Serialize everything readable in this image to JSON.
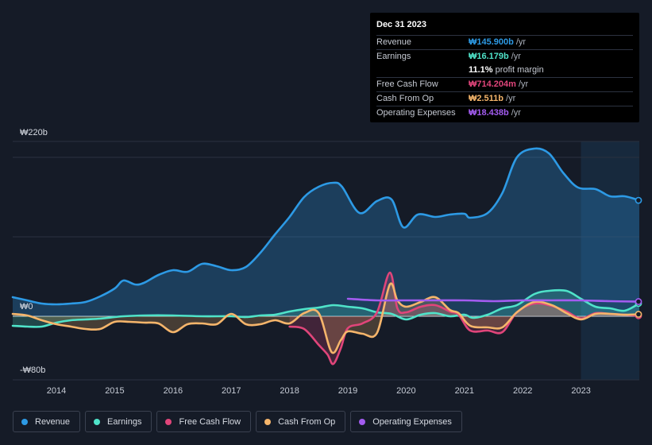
{
  "tooltip": {
    "date": "Dec 31 2023",
    "rows": [
      {
        "label": "Revenue",
        "value": "₩145.900b",
        "unit": "/yr",
        "color": "#2d9ae5"
      },
      {
        "label": "Earnings",
        "value": "₩16.179b",
        "unit": "/yr",
        "color": "#4fe3c9"
      },
      {
        "label": "",
        "value": "11.1%",
        "unit": "profit margin",
        "color": "#ffffff"
      },
      {
        "label": "Free Cash Flow",
        "value": "₩714.204m",
        "unit": "/yr",
        "color": "#e0457a"
      },
      {
        "label": "Cash From Op",
        "value": "₩2.511b",
        "unit": "/yr",
        "color": "#f5b56b"
      },
      {
        "label": "Operating Expenses",
        "value": "₩18.438b",
        "unit": "/yr",
        "color": "#a35cf0"
      }
    ]
  },
  "chart_data": {
    "type": "area",
    "yaxis_labels": {
      "top": "₩220b",
      "zero": "₩0",
      "bottom": "-₩80b"
    },
    "ylim": [
      -80,
      220
    ],
    "x_ticks": [
      "2014",
      "2015",
      "2016",
      "2017",
      "2018",
      "2019",
      "2020",
      "2021",
      "2022",
      "2023"
    ],
    "xlim": [
      2013.25,
      2024.0
    ],
    "highlight_start": 2023.0,
    "grid": true,
    "series": [
      {
        "name": "Revenue",
        "color": "#2d9ae5",
        "fill": true,
        "points": [
          [
            2013.25,
            24
          ],
          [
            2013.5,
            20
          ],
          [
            2013.75,
            16
          ],
          [
            2014.0,
            15
          ],
          [
            2014.25,
            16
          ],
          [
            2014.5,
            18
          ],
          [
            2014.75,
            25
          ],
          [
            2015.0,
            35
          ],
          [
            2015.15,
            45
          ],
          [
            2015.35,
            40
          ],
          [
            2015.5,
            42
          ],
          [
            2015.75,
            52
          ],
          [
            2016.0,
            58
          ],
          [
            2016.25,
            56
          ],
          [
            2016.5,
            66
          ],
          [
            2016.75,
            63
          ],
          [
            2017.0,
            58
          ],
          [
            2017.25,
            62
          ],
          [
            2017.5,
            80
          ],
          [
            2017.75,
            103
          ],
          [
            2018.0,
            125
          ],
          [
            2018.25,
            150
          ],
          [
            2018.5,
            163
          ],
          [
            2018.75,
            168
          ],
          [
            2018.9,
            163
          ],
          [
            2019.2,
            130
          ],
          [
            2019.5,
            145
          ],
          [
            2019.75,
            147
          ],
          [
            2019.95,
            112
          ],
          [
            2020.2,
            128
          ],
          [
            2020.5,
            125
          ],
          [
            2020.75,
            128
          ],
          [
            2021.0,
            129
          ],
          [
            2021.1,
            124
          ],
          [
            2021.4,
            130
          ],
          [
            2021.65,
            155
          ],
          [
            2021.9,
            200
          ],
          [
            2022.2,
            211
          ],
          [
            2022.45,
            205
          ],
          [
            2022.7,
            180
          ],
          [
            2022.95,
            162
          ],
          [
            2023.25,
            160
          ],
          [
            2023.5,
            151
          ],
          [
            2023.75,
            151
          ],
          [
            2024.0,
            145.9
          ]
        ]
      },
      {
        "name": "Earnings",
        "color": "#4fe3c9",
        "fill": true,
        "points": [
          [
            2013.25,
            -12
          ],
          [
            2013.5,
            -13
          ],
          [
            2013.75,
            -13
          ],
          [
            2014.0,
            -8
          ],
          [
            2014.25,
            -5
          ],
          [
            2014.5,
            -4
          ],
          [
            2014.75,
            -3
          ],
          [
            2015.0,
            -1
          ],
          [
            2015.15,
            0
          ],
          [
            2015.5,
            1
          ],
          [
            2016.0,
            1
          ],
          [
            2016.5,
            0
          ],
          [
            2017.0,
            0
          ],
          [
            2017.25,
            -1
          ],
          [
            2017.5,
            1
          ],
          [
            2017.75,
            2
          ],
          [
            2018.0,
            6
          ],
          [
            2018.25,
            9
          ],
          [
            2018.5,
            11
          ],
          [
            2018.75,
            14
          ],
          [
            2019.0,
            12
          ],
          [
            2019.25,
            10
          ],
          [
            2019.5,
            5
          ],
          [
            2019.75,
            3
          ],
          [
            2020.0,
            -4
          ],
          [
            2020.25,
            2
          ],
          [
            2020.5,
            4
          ],
          [
            2020.75,
            0
          ],
          [
            2021.0,
            2
          ],
          [
            2021.15,
            -2
          ],
          [
            2021.4,
            2
          ],
          [
            2021.65,
            10
          ],
          [
            2021.9,
            14
          ],
          [
            2022.2,
            28
          ],
          [
            2022.45,
            32
          ],
          [
            2022.75,
            32
          ],
          [
            2023.0,
            22
          ],
          [
            2023.25,
            12
          ],
          [
            2023.5,
            10
          ],
          [
            2023.75,
            7
          ],
          [
            2024.0,
            16.18
          ]
        ]
      },
      {
        "name": "Free Cash Flow",
        "color": "#e0457a",
        "fill": true,
        "points": [
          [
            2018.0,
            -13
          ],
          [
            2018.25,
            -16
          ],
          [
            2018.5,
            -36
          ],
          [
            2018.65,
            -48
          ],
          [
            2018.75,
            -60
          ],
          [
            2018.88,
            -40
          ],
          [
            2019.0,
            -15
          ],
          [
            2019.25,
            -9
          ],
          [
            2019.5,
            5
          ],
          [
            2019.72,
            55
          ],
          [
            2019.85,
            10
          ],
          [
            2020.0,
            5
          ],
          [
            2020.25,
            12
          ],
          [
            2020.5,
            14
          ],
          [
            2020.75,
            6
          ],
          [
            2020.9,
            2
          ],
          [
            2021.1,
            -18
          ],
          [
            2021.4,
            -18
          ],
          [
            2021.65,
            -20
          ],
          [
            2021.9,
            5
          ],
          [
            2022.2,
            16
          ],
          [
            2022.5,
            13
          ],
          [
            2022.75,
            6
          ],
          [
            2023.0,
            -3
          ],
          [
            2023.25,
            4
          ],
          [
            2023.5,
            3
          ],
          [
            2023.75,
            2
          ],
          [
            2024.0,
            0.71
          ]
        ]
      },
      {
        "name": "Cash From Op",
        "color": "#f5b56b",
        "fill": true,
        "points": [
          [
            2013.25,
            3
          ],
          [
            2013.5,
            1
          ],
          [
            2013.75,
            -5
          ],
          [
            2014.0,
            -10
          ],
          [
            2014.25,
            -13
          ],
          [
            2014.5,
            -16
          ],
          [
            2014.75,
            -16
          ],
          [
            2015.0,
            -7
          ],
          [
            2015.25,
            -7
          ],
          [
            2015.5,
            -8
          ],
          [
            2015.75,
            -9
          ],
          [
            2016.0,
            -20
          ],
          [
            2016.25,
            -10
          ],
          [
            2016.5,
            -9
          ],
          [
            2016.75,
            -10
          ],
          [
            2017.0,
            3
          ],
          [
            2017.25,
            -10
          ],
          [
            2017.5,
            -10
          ],
          [
            2017.75,
            -5
          ],
          [
            2018.0,
            -9
          ],
          [
            2018.25,
            4
          ],
          [
            2018.5,
            4
          ],
          [
            2018.72,
            -45
          ],
          [
            2018.88,
            -30
          ],
          [
            2019.0,
            -19
          ],
          [
            2019.25,
            -22
          ],
          [
            2019.5,
            -21
          ],
          [
            2019.72,
            40
          ],
          [
            2019.85,
            20
          ],
          [
            2020.0,
            12
          ],
          [
            2020.25,
            18
          ],
          [
            2020.5,
            24
          ],
          [
            2020.75,
            8
          ],
          [
            2020.9,
            4
          ],
          [
            2021.1,
            -12
          ],
          [
            2021.4,
            -14
          ],
          [
            2021.65,
            -14
          ],
          [
            2021.9,
            5
          ],
          [
            2022.2,
            18
          ],
          [
            2022.5,
            14
          ],
          [
            2022.75,
            4
          ],
          [
            2023.0,
            -4
          ],
          [
            2023.25,
            3
          ],
          [
            2023.5,
            3
          ],
          [
            2023.75,
            2
          ],
          [
            2024.0,
            2.51
          ]
        ]
      },
      {
        "name": "Operating Expenses",
        "color": "#a35cf0",
        "fill": false,
        "points": [
          [
            2019.0,
            22
          ],
          [
            2019.5,
            20
          ],
          [
            2020.0,
            20
          ],
          [
            2020.5,
            20
          ],
          [
            2021.0,
            20
          ],
          [
            2021.5,
            19
          ],
          [
            2022.0,
            20
          ],
          [
            2022.5,
            20
          ],
          [
            2023.0,
            20
          ],
          [
            2023.5,
            19
          ],
          [
            2024.0,
            18.44
          ]
        ]
      }
    ]
  },
  "legend": [
    {
      "label": "Revenue",
      "color": "#2d9ae5"
    },
    {
      "label": "Earnings",
      "color": "#4fe3c9"
    },
    {
      "label": "Free Cash Flow",
      "color": "#e0457a"
    },
    {
      "label": "Cash From Op",
      "color": "#f5b56b"
    },
    {
      "label": "Operating Expenses",
      "color": "#a35cf0"
    }
  ]
}
